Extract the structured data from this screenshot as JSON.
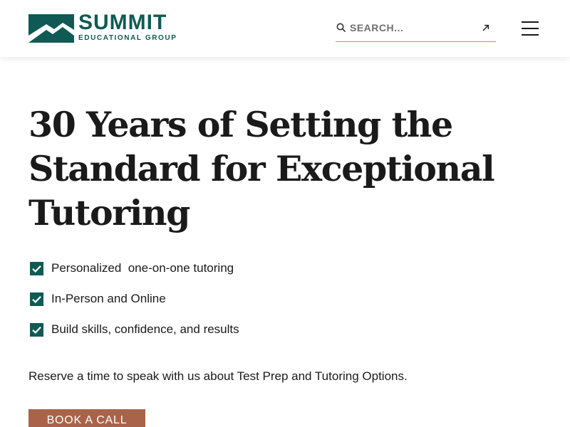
{
  "colors": {
    "brand_teal": "#0f5a55",
    "accent_gold": "#b39a6b",
    "cta_background": "#a9634a",
    "text": "#1a1a1a"
  },
  "header": {
    "logo": {
      "name": "SUMMIT",
      "tagline": "EDUCATIONAL GROUP",
      "mark_icon": "mountain-logo-mark"
    },
    "search": {
      "placeholder": "SEARCH...",
      "value": "",
      "icon": "search-icon",
      "submit_icon": "arrow-up-right-icon"
    },
    "menu_icon": "hamburger-menu-icon"
  },
  "hero": {
    "title": "30 Years of Setting the Standard for Exceptional Tutoring",
    "features": [
      {
        "icon": "checkbox-checked-icon",
        "label": "Personalized  one-on-one tutoring"
      },
      {
        "icon": "checkbox-checked-icon",
        "label": "In-Person and Online"
      },
      {
        "icon": "checkbox-checked-icon",
        "label": "Build skills, confidence, and results"
      }
    ],
    "reserve_text": "Reserve a time to speak with us about Test Prep and Tutoring Options.",
    "cta_label": "BOOK A CALL"
  }
}
